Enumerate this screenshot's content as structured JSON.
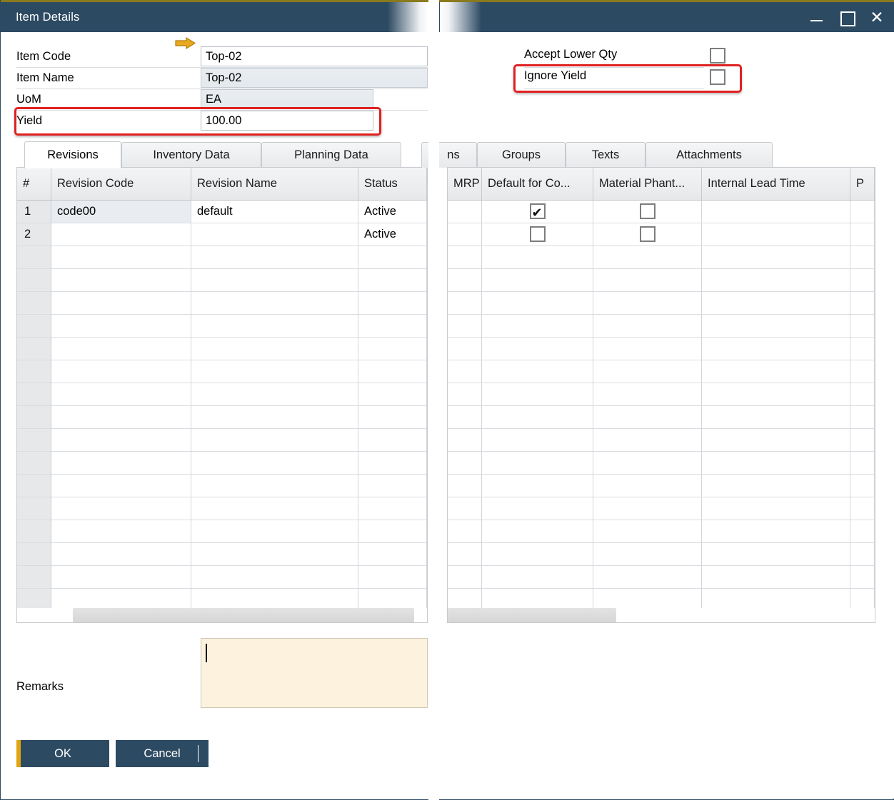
{
  "window": {
    "title": "Item Details",
    "accent_gold": "#8a7a1e",
    "titlebar_color": "#2d4a63",
    "controls": {
      "minimize": "minimize",
      "maximize": "maximize",
      "close": "✕"
    }
  },
  "form": {
    "fields": [
      {
        "label": "Item Code",
        "value": "Top-02",
        "state": "editable",
        "has_arrow": true
      },
      {
        "label": "Item Name",
        "value": "Top-02",
        "state": "readonly",
        "has_arrow": false
      },
      {
        "label": "UoM",
        "value": "EA",
        "state": "readonly",
        "has_arrow": false
      },
      {
        "label": "Yield",
        "value": "100.00",
        "state": "editable",
        "has_arrow": false
      }
    ],
    "checkboxes": [
      {
        "label": "Accept Lower Qty",
        "checked": false
      },
      {
        "label": "Ignore Yield",
        "checked": false
      }
    ]
  },
  "annotations": [
    {
      "target": "Yield",
      "color": "#e02020"
    },
    {
      "target": "Ignore Yield",
      "color": "#e02020"
    }
  ],
  "left_panel": {
    "tabs": [
      {
        "label": "Revisions",
        "active": true
      },
      {
        "label": "Inventory Data",
        "active": false
      },
      {
        "label": "Planning Data",
        "active": false
      }
    ],
    "grid": {
      "columns": [
        "#",
        "Revision Code",
        "Revision Name",
        "Status"
      ],
      "rows": [
        {
          "num": "1",
          "revision_code": "code00",
          "revision_name": "default",
          "status": "Active"
        },
        {
          "num": "2",
          "revision_code": "",
          "revision_name": "",
          "status": "Active"
        }
      ],
      "empty_rows": 16
    }
  },
  "right_panel": {
    "tabs": [
      {
        "label": "ns",
        "active": false,
        "clipped": true
      },
      {
        "label": "Groups",
        "active": false
      },
      {
        "label": "Texts",
        "active": false
      },
      {
        "label": "Attachments",
        "active": false
      }
    ],
    "grid": {
      "columns": [
        "MRP",
        "Default for Co...",
        "Material Phant...",
        "Internal Lead Time",
        "P"
      ],
      "rows": [
        {
          "mrp": "",
          "default_for_co": true,
          "material_phantom": false,
          "internal_lead_time": "",
          "last": ""
        },
        {
          "mrp": "",
          "default_for_co": false,
          "material_phantom": false,
          "internal_lead_time": "",
          "last": ""
        }
      ],
      "empty_rows": 16
    }
  },
  "footer": {
    "remarks_label": "Remarks",
    "remarks_value": "",
    "ok_label": "OK",
    "cancel_label": "Cancel"
  }
}
